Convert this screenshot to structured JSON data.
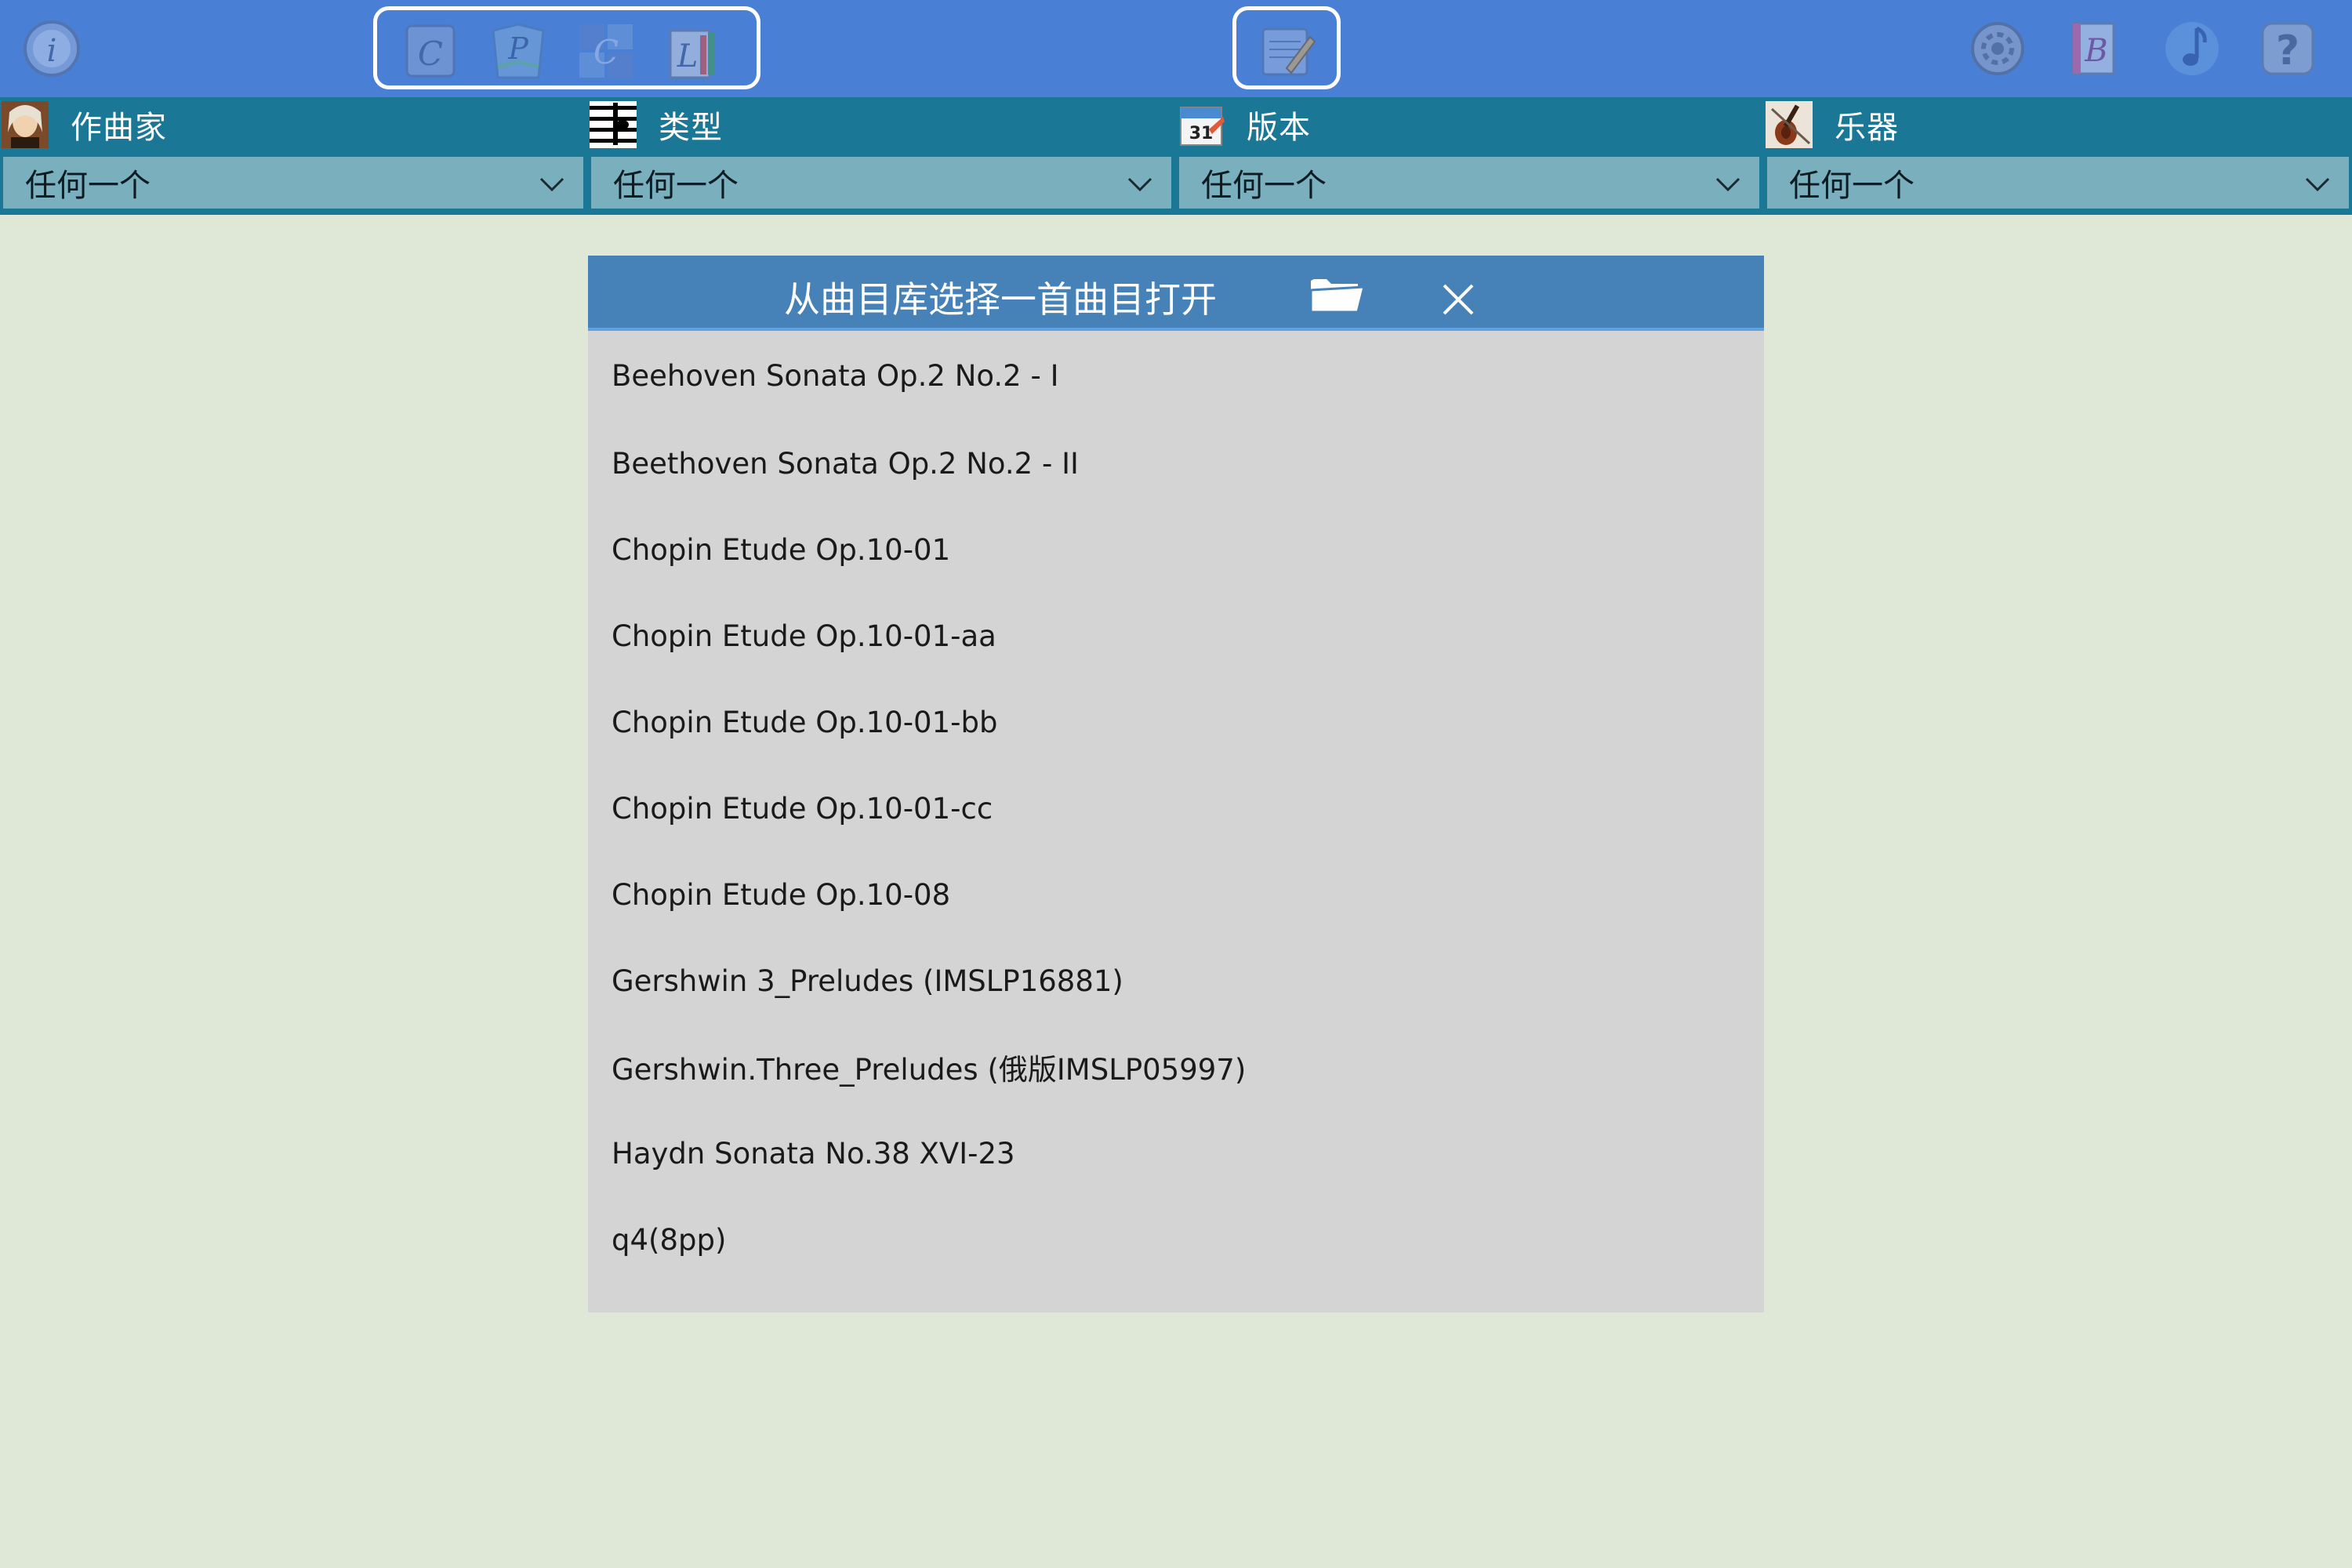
{
  "toolbar": {
    "left_icon": "info-icon",
    "group_icons": [
      "c-document-icon",
      "p-book-icon",
      "c-grid-icon",
      "l-library-icon"
    ],
    "center_icon": "edit-score-icon",
    "right_icons": [
      "settings-icon",
      "b-book-icon",
      "music-note-icon",
      "help-icon"
    ],
    "accent": "#4a7fd6"
  },
  "filters": [
    {
      "label": "作曲家",
      "icon": "composer-portrait-icon",
      "value": "任何一个"
    },
    {
      "label": "类型",
      "icon": "sheet-music-icon",
      "value": "任何一个"
    },
    {
      "label": "版本",
      "icon": "calendar-icon",
      "value": "任何一个"
    },
    {
      "label": "乐器",
      "icon": "violin-icon",
      "value": "任何一个"
    }
  ],
  "dialog": {
    "title": "从曲目库选择一首曲目打开",
    "open_icon": "folder-open-icon",
    "close_icon": "close-icon",
    "songs": [
      "Beehoven Sonata Op.2 No.2 - I",
      "Beethoven Sonata Op.2 No.2 - II",
      "Chopin Etude Op.10-01",
      "Chopin Etude Op.10-01-aa",
      "Chopin Etude Op.10-01-bb",
      "Chopin Etude Op.10-01-cc",
      "Chopin Etude Op.10-08",
      "Gershwin 3_Preludes (IMSLP16881)",
      "Gershwin.Three_Preludes (俄版IMSLP05997)",
      "Haydn Sonata No.38 XVI-23",
      "q4(8pp)"
    ]
  }
}
